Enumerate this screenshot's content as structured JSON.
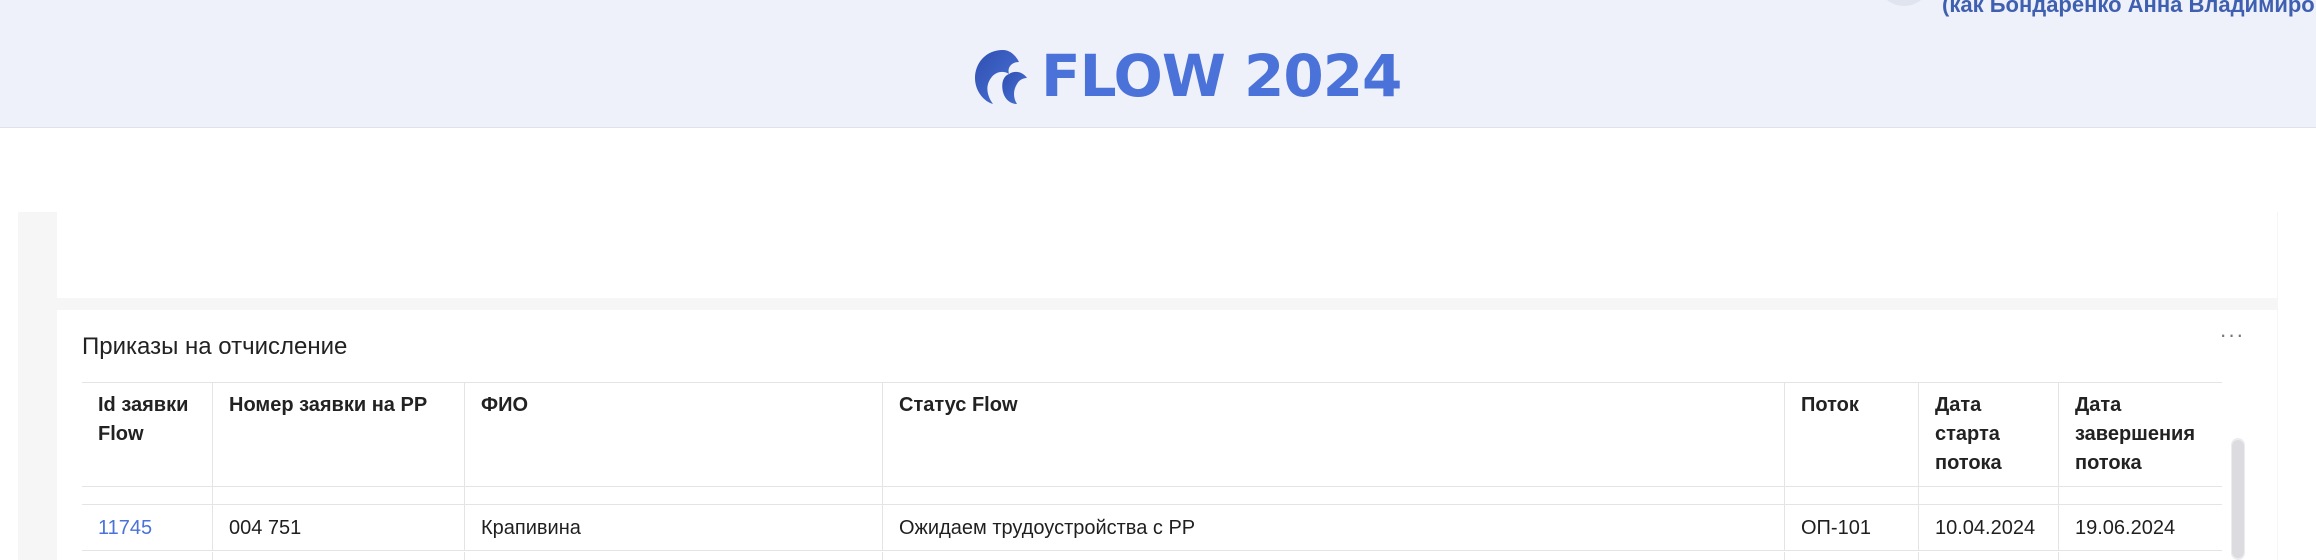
{
  "header": {
    "user_as": "(как Бондаренко Анна Владимировна)",
    "logo_text": "FLOW 2024",
    "logo_color": "#4a72d8",
    "background": "#eef1f9"
  },
  "widget": {
    "title": "Приказы на отчисление",
    "menu_label": "···",
    "columns": [
      "Id заявки Flow",
      "Номер заявки на РР",
      "ФИО",
      "Статус Flow",
      "Поток",
      "Дата старта потока",
      "Дата завершения потока"
    ],
    "rows": [
      {
        "id": "11745",
        "number": "004 751",
        "fio": "Крапивина",
        "status": "Ожидаем трудоустройства с РР",
        "stream": "ОП-101",
        "start": "10.04.2024",
        "end": "19.06.2024"
      }
    ]
  },
  "link_color": "#4a72d8"
}
